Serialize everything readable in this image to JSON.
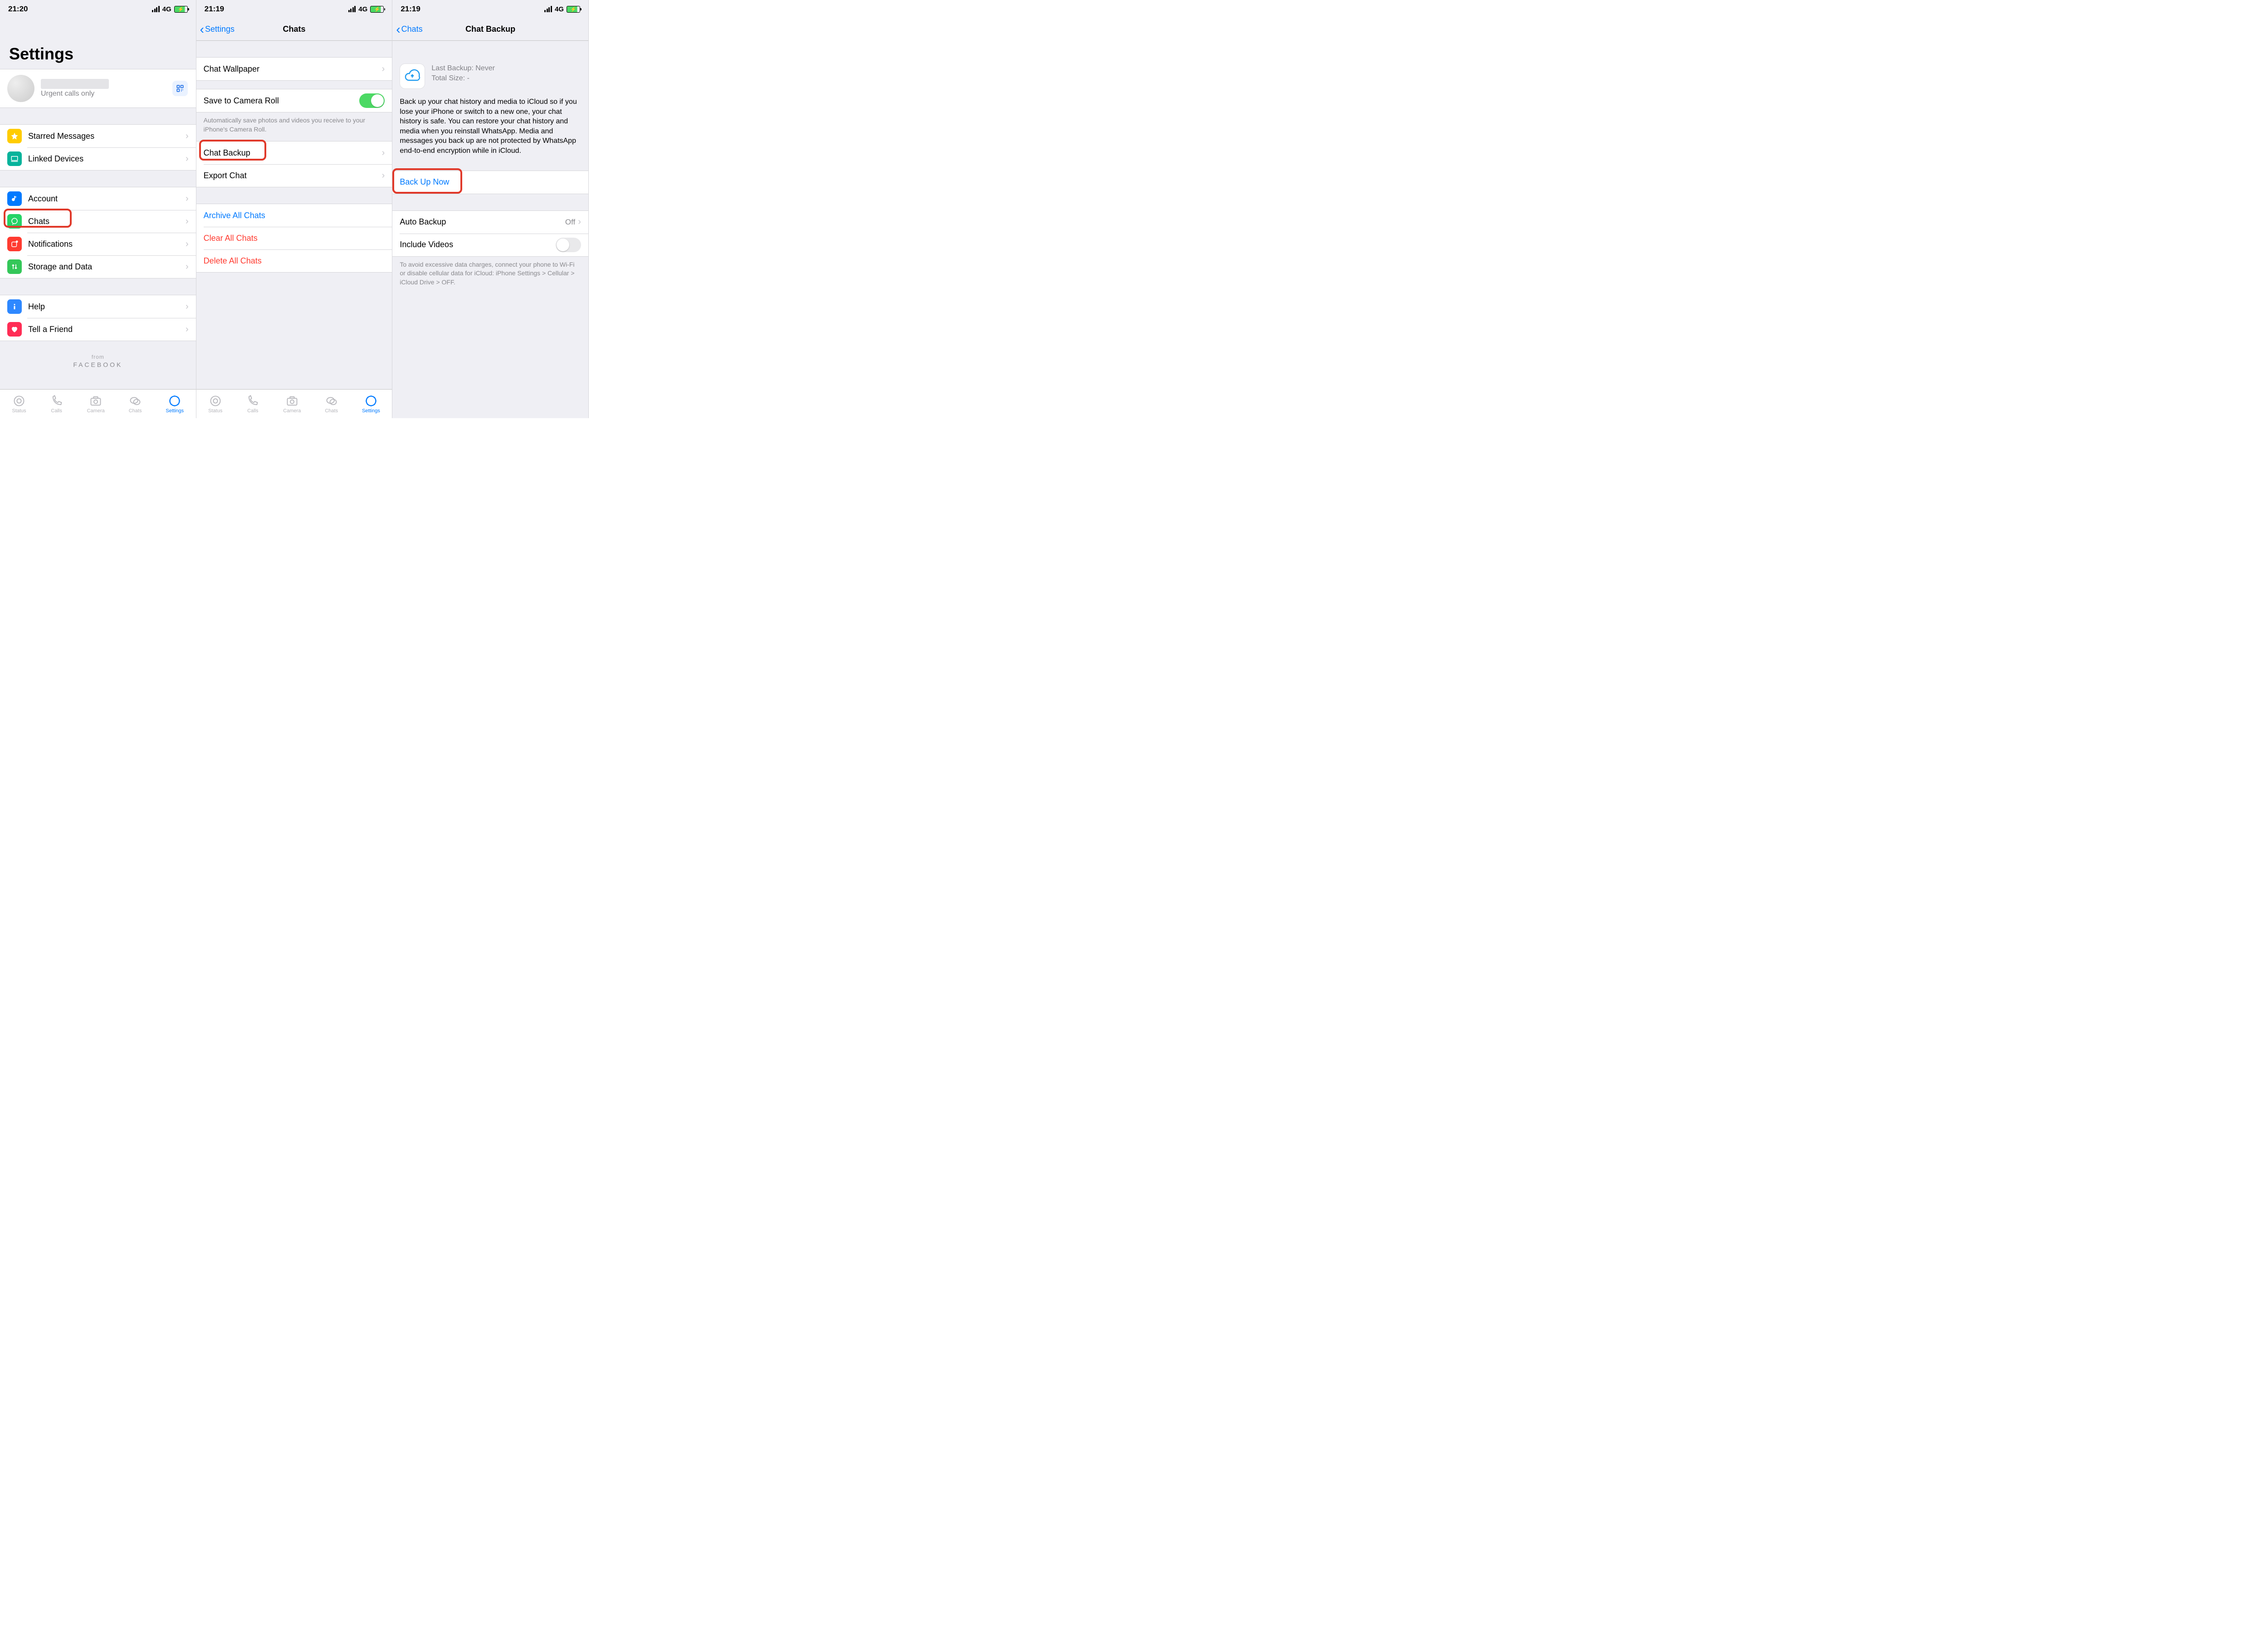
{
  "status": {
    "time1": "21:20",
    "time2": "21:19",
    "time3": "21:19",
    "net": "4G"
  },
  "pane1": {
    "title": "Settings",
    "profile_status": "Urgent calls only",
    "row_starred": "Starred Messages",
    "row_linked": "Linked Devices",
    "row_account": "Account",
    "row_chats": "Chats",
    "row_notifications": "Notifications",
    "row_storage": "Storage and Data",
    "row_help": "Help",
    "row_tell": "Tell a Friend",
    "from_label": "from",
    "from_brand": "FACEBOOK"
  },
  "pane2": {
    "back": "Settings",
    "title": "Chats",
    "row_wallpaper": "Chat Wallpaper",
    "row_save_roll": "Save to Camera Roll",
    "save_roll_footer": "Automatically save photos and videos you receive to your iPhone's Camera Roll.",
    "row_chat_backup": "Chat Backup",
    "row_export": "Export Chat",
    "row_archive": "Archive All Chats",
    "row_clear": "Clear All Chats",
    "row_delete": "Delete All Chats"
  },
  "pane3": {
    "back": "Chats",
    "title": "Chat Backup",
    "last_backup": "Last Backup: Never",
    "total_size": "Total Size: -",
    "desc": "Back up your chat history and media to iCloud so if you lose your iPhone or switch to a new one, your chat history is safe. You can restore your chat history and media when you reinstall WhatsApp. Media and messages you back up are not protected by WhatsApp end-to-end encryption while in iCloud.",
    "backup_now": "Back Up Now",
    "auto_backup": "Auto Backup",
    "auto_backup_val": "Off",
    "include_videos": "Include Videos",
    "footer": "To avoid excessive data charges, connect your phone to Wi-Fi or disable cellular data for iCloud: iPhone Settings > Cellular > iCloud Drive > OFF."
  },
  "tabs": {
    "status": "Status",
    "calls": "Calls",
    "camera": "Camera",
    "chats": "Chats",
    "settings": "Settings"
  }
}
